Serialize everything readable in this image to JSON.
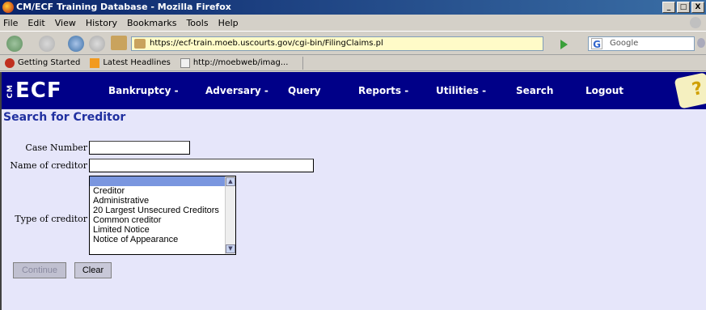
{
  "window": {
    "title": "CM/ECF Training Database - Mozilla Firefox",
    "buttons": [
      "_",
      "□",
      "X"
    ]
  },
  "menu": [
    "File",
    "Edit",
    "View",
    "History",
    "Bookmarks",
    "Tools",
    "Help"
  ],
  "nav": {
    "url": "https://ecf-train.moeb.uscourts.gov/cgi-bin/FilingClaims.pl",
    "search_placeholder": "Google"
  },
  "bookmarks": [
    "Getting Started",
    "Latest Headlines",
    "http://moebweb/imag..."
  ],
  "ecf": {
    "logo_small": "CM",
    "logo_main": "ECF",
    "menu": [
      "Bankruptcy -",
      "Adversary -",
      "Query",
      "Reports -",
      "Utilities -",
      "Search",
      "Logout"
    ],
    "help": "?"
  },
  "page": {
    "title": "Search for Creditor",
    "case_number_label": "Case Number",
    "case_number_value": "",
    "creditor_name_label": "Name of creditor",
    "creditor_name_value": "",
    "creditor_type_label": "Type of creditor",
    "creditor_types": [
      "Creditor",
      "Administrative",
      "20 Largest Unsecured Creditors",
      "Common creditor",
      "Limited Notice",
      "Notice of Appearance"
    ],
    "continue_label": "Continue",
    "clear_label": "Clear"
  }
}
